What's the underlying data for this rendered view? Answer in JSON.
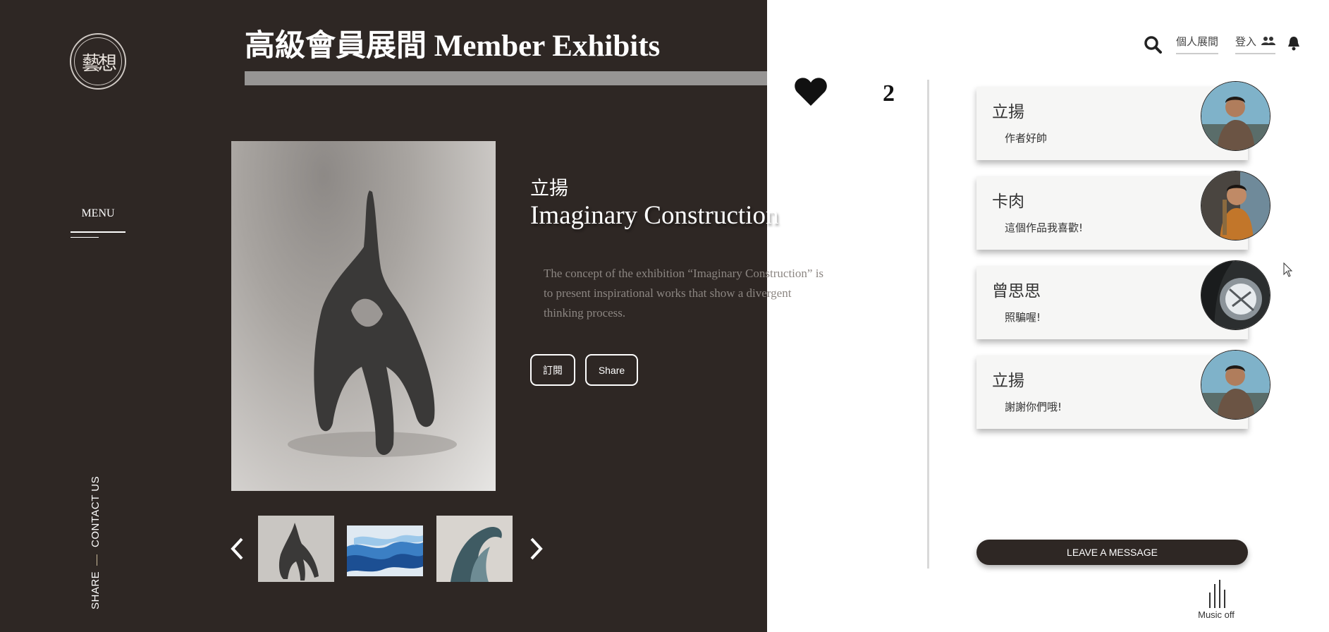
{
  "sidebar": {
    "logo_text": "藝想",
    "menu_label": "MENU",
    "contact_label": "CONTACT US",
    "share_label": "SHARE"
  },
  "header": {
    "title": "高級會員展間 Member Exhibits"
  },
  "nav": {
    "search_icon": "search-icon",
    "exhibit_label": "個人展間",
    "login_label": "登入",
    "users_icon": "users-icon",
    "bell_icon": "bell-icon"
  },
  "artwork": {
    "artist": "立揚",
    "title": "Imaginary Construction",
    "description": "The concept of the exhibition “Imaginary Construction” is to present inspirational works that show a divergent thinking process.",
    "subscribe_label": "訂閱",
    "share_label": "Share"
  },
  "gallery": {
    "thumbnails": [
      "thumbnail-sculpture",
      "thumbnail-glass-waves",
      "thumbnail-wave-sculpture"
    ]
  },
  "likes": {
    "icon": "heart-icon",
    "count": "2"
  },
  "comments": [
    {
      "name": "立揚",
      "text": "作者好帥"
    },
    {
      "name": "卡肉",
      "text": "這個作品我喜歡!"
    },
    {
      "name": "曾思思",
      "text": "照騙喔!"
    },
    {
      "name": "立揚",
      "text": "謝謝你們哦!"
    }
  ],
  "leave_message_label": "LEAVE A MESSAGE",
  "music": {
    "label": "Music off"
  },
  "colors": {
    "dark_bg": "#2e2724",
    "title_bar": "#979594",
    "card_bg": "#f6f6f5"
  }
}
